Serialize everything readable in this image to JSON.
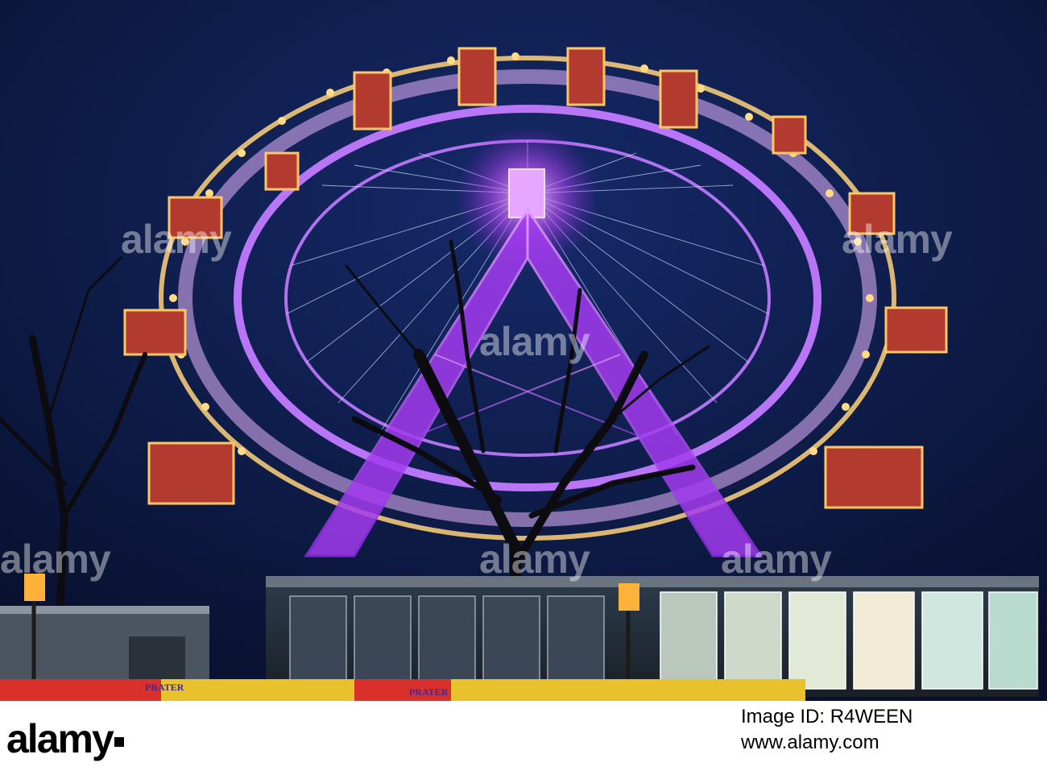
{
  "image": {
    "subject": "Ferris wheel at night",
    "wheel_colors": {
      "frame": "#c27bff",
      "rim_lights": "#ffd27a",
      "cabin": "#c23b2e",
      "sky": "#0d1a44"
    }
  },
  "signage": {
    "banner_left": "PRATER",
    "banner_right": "PRATER"
  },
  "watermark": {
    "text": "alamy"
  },
  "footer": {
    "logo": "alamy",
    "image_id_line": "Image ID: R4WEEN",
    "url": "www.alamy.com"
  }
}
